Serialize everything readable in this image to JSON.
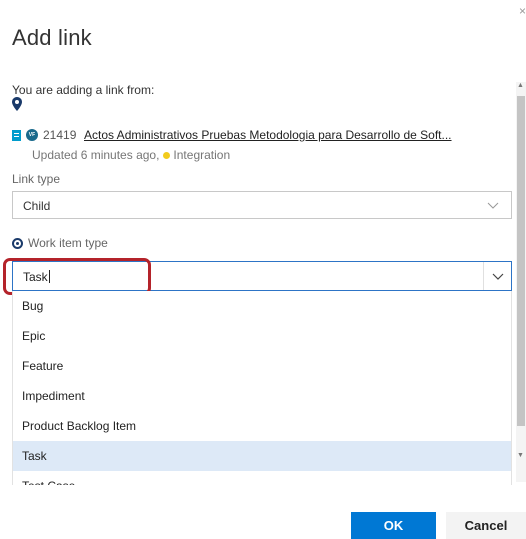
{
  "dialog": {
    "title": "Add link",
    "close_glyph": "×"
  },
  "source": {
    "heading": "You are adding a link from:",
    "pin_icon": "location-pin-icon",
    "work_item": {
      "type_icon": "product-backlog-item-icon",
      "avatar_initials": "VF",
      "id": "21419",
      "title": "Actos Administrativos Pruebas Metodologia para Desarrollo de Soft...",
      "updated": "Updated 6 minutes ago,",
      "state": "Integration",
      "state_color": "#f2cb1d"
    }
  },
  "link_type": {
    "label": "Link type",
    "value": "Child"
  },
  "work_item_type": {
    "radio_label": "Work item type",
    "value": "Task",
    "options": [
      "Bug",
      "Epic",
      "Feature",
      "Impediment",
      "Product Backlog Item",
      "Task",
      "Test Case"
    ],
    "selected_index": 5
  },
  "buttons": {
    "ok": "OK",
    "cancel": "Cancel"
  },
  "colors": {
    "accent": "#0078d4",
    "highlight_annotation": "#b4232a",
    "selected_option_bg": "#dde9f7"
  }
}
